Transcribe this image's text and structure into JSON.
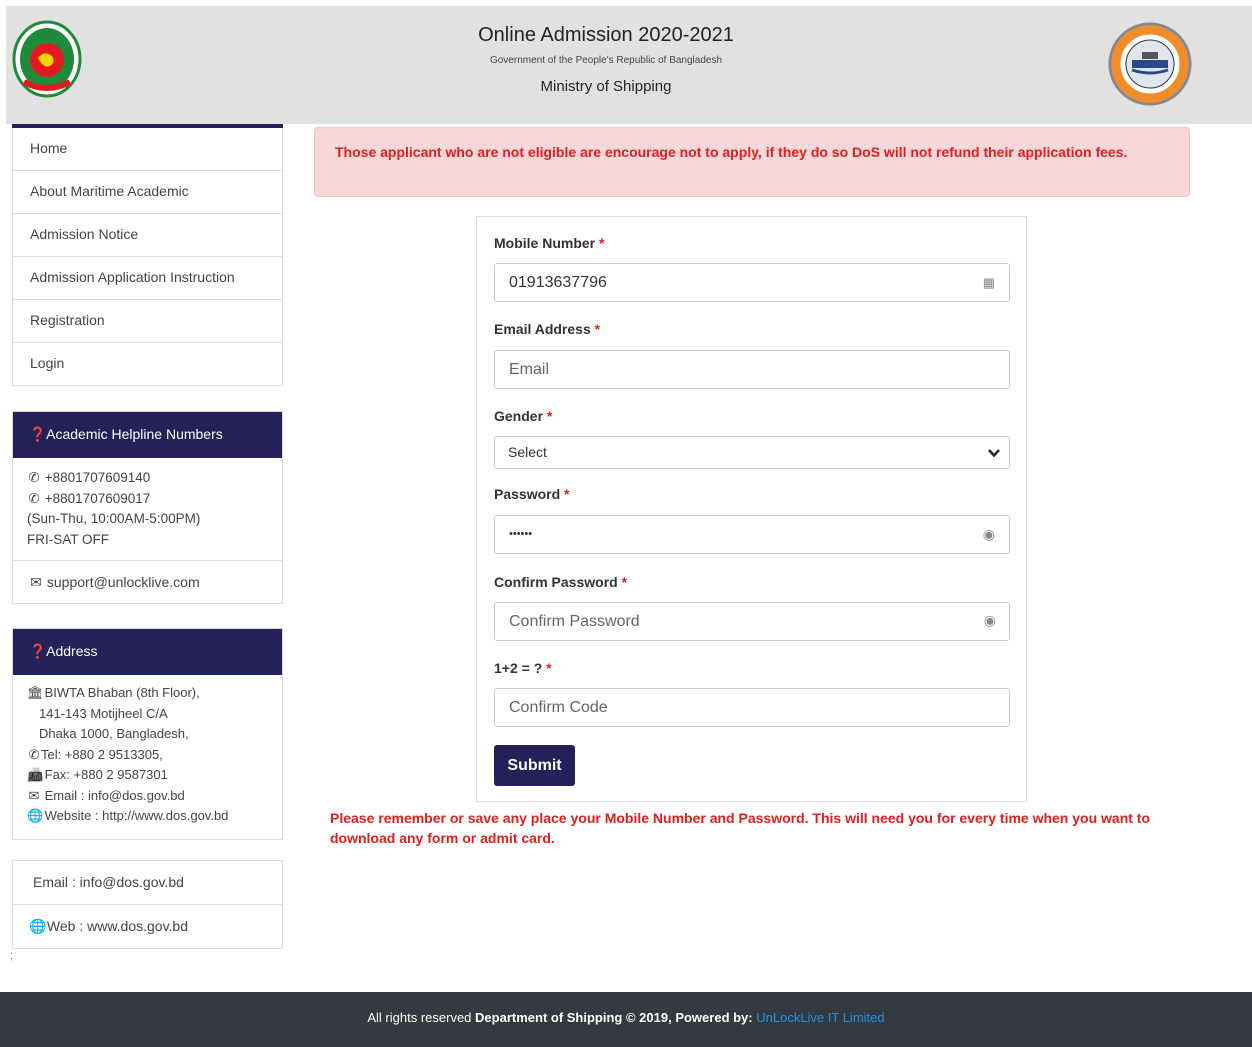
{
  "header": {
    "title": "Online Admission 2020-2021",
    "subtitle": "Government of the People's Republic of Bangladesh",
    "ministry": "Ministry of Shipping"
  },
  "nav": {
    "items": [
      {
        "label": "Home"
      },
      {
        "label": "About Maritime Academic"
      },
      {
        "label": "Admission Notice"
      },
      {
        "label": "Admission Application Instruction"
      },
      {
        "label": "Registration"
      },
      {
        "label": "Login"
      }
    ]
  },
  "helpline": {
    "title": "Academic Helpline Numbers",
    "phone1": "+8801707609140",
    "phone2": "+8801707609017",
    "hours": "(Sun-Thu, 10:00AM-5:00PM)",
    "off": "FRI-SAT OFF",
    "email": "support@unlocklive.com"
  },
  "address": {
    "title": "Address",
    "line1": "BIWTA Bhaban (8th Floor),",
    "line2": "141-143 Motijheel C/A",
    "line3": "Dhaka 1000, Bangladesh,",
    "tel": "Tel: +880 2 9513305,",
    "fax": "Fax: +880 2 9587301",
    "email": "Email : info@dos.gov.bd",
    "website": "Website : http://www.dos.gov.bd"
  },
  "contact": {
    "email": "Email : info@dos.gov.bd",
    "web": "Web : www.dos.gov.bd"
  },
  "alert": {
    "text": "Those applicant who are not eligible are encourage not to apply, if they do so DoS will not refund their application fees."
  },
  "form": {
    "mobile_label": "Mobile Number",
    "mobile_value": "01913637796",
    "email_label": "Email Address",
    "email_placeholder": "Email",
    "gender_label": "Gender",
    "gender_value": "Select",
    "password_label": "Password",
    "password_value": "••••••",
    "confirm_label": "Confirm Password",
    "confirm_placeholder": "Confirm Password",
    "captcha_label": "1+2 = ?",
    "captcha_placeholder": "Confirm Code",
    "required_mark": "*",
    "submit_label": "Submit"
  },
  "note": {
    "text": "Please remember or save any place your Mobile Number and Password. This will need you for every time when you want to download any form or admit card."
  },
  "stray": ";",
  "footer": {
    "prefix": "All rights reserved ",
    "org": "Department of Shipping",
    "middle": " © 2019, Powered by: ",
    "link": "UnLockLive IT Limited"
  },
  "colors": {
    "brand": "#23205a",
    "alert_bg": "#f8d7da",
    "danger": "#e01e1e",
    "footer_bg": "#343a40",
    "link": "#1f90e8"
  }
}
